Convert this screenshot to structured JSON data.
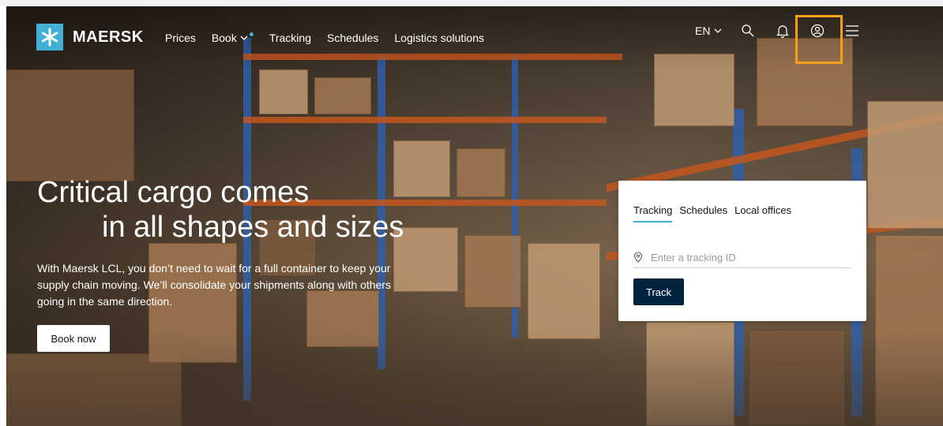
{
  "brand": {
    "name": "MAERSK",
    "color": "#42b0d5"
  },
  "nav": {
    "items": [
      {
        "label": "Prices"
      },
      {
        "label": "Book",
        "has_dropdown": true,
        "indicator": true
      },
      {
        "label": "Tracking"
      },
      {
        "label": "Schedules"
      },
      {
        "label": "Logistics solutions"
      }
    ],
    "language": "EN",
    "icons": [
      "search-icon",
      "bell-icon",
      "user-icon",
      "menu-icon"
    ],
    "highlighted_icon": "user-icon",
    "highlight_color": "#f5a01a"
  },
  "hero": {
    "headline_line1": "Critical cargo comes",
    "headline_line2": "in all shapes and sizes",
    "subtext": "With Maersk LCL, you don’t need to wait for a full container to keep your supply chain moving. We’ll consolidate your shipments along with others going in the same direction.",
    "cta_label": "Book now"
  },
  "tracking_card": {
    "tabs": [
      {
        "label": "Tracking",
        "active": true
      },
      {
        "label": "Schedules",
        "active": false
      },
      {
        "label": "Local offices",
        "active": false
      }
    ],
    "input_placeholder": "Enter a tracking ID",
    "input_value": "",
    "button_label": "Track",
    "button_color": "#00243d"
  }
}
